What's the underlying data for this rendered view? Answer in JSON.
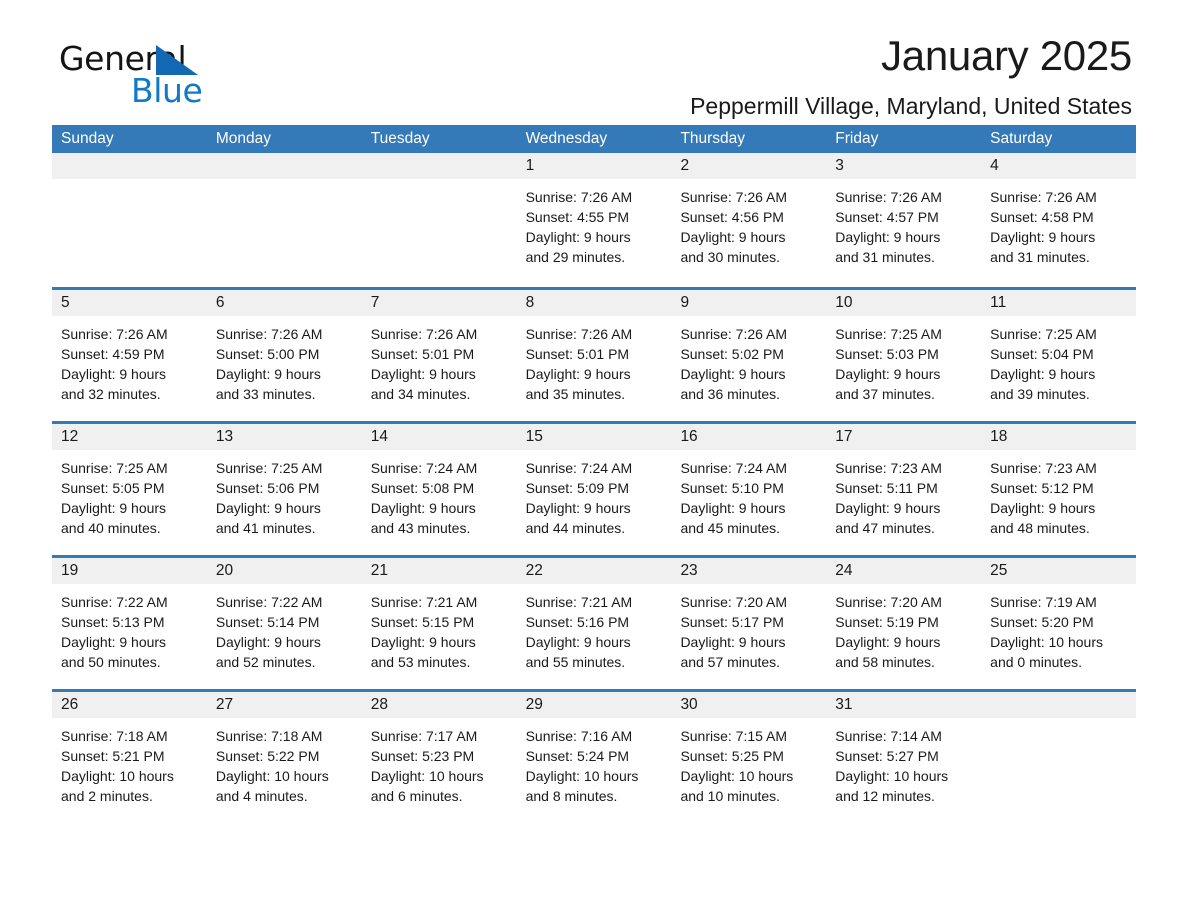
{
  "brand": {
    "name_part1": "General",
    "name_part2": "Blue",
    "accent_color": "#1279c6",
    "triangle_color": "#1268b3"
  },
  "header": {
    "title": "January 2025",
    "subtitle": "Peppermill Village, Maryland, United States"
  },
  "theme": {
    "header_row_bg": "#3479b8",
    "daynum_bg": "#f0f0f0",
    "separator_color": "#3479b8"
  },
  "weekdays": [
    "Sunday",
    "Monday",
    "Tuesday",
    "Wednesday",
    "Thursday",
    "Friday",
    "Saturday"
  ],
  "weeks": [
    [
      {
        "day": "",
        "l1": "",
        "l2": "",
        "l3": "",
        "l4": ""
      },
      {
        "day": "",
        "l1": "",
        "l2": "",
        "l3": "",
        "l4": ""
      },
      {
        "day": "",
        "l1": "",
        "l2": "",
        "l3": "",
        "l4": ""
      },
      {
        "day": "1",
        "l1": "Sunrise: 7:26 AM",
        "l2": "Sunset: 4:55 PM",
        "l3": "Daylight: 9 hours",
        "l4": "and 29 minutes."
      },
      {
        "day": "2",
        "l1": "Sunrise: 7:26 AM",
        "l2": "Sunset: 4:56 PM",
        "l3": "Daylight: 9 hours",
        "l4": "and 30 minutes."
      },
      {
        "day": "3",
        "l1": "Sunrise: 7:26 AM",
        "l2": "Sunset: 4:57 PM",
        "l3": "Daylight: 9 hours",
        "l4": "and 31 minutes."
      },
      {
        "day": "4",
        "l1": "Sunrise: 7:26 AM",
        "l2": "Sunset: 4:58 PM",
        "l3": "Daylight: 9 hours",
        "l4": "and 31 minutes."
      }
    ],
    [
      {
        "day": "5",
        "l1": "Sunrise: 7:26 AM",
        "l2": "Sunset: 4:59 PM",
        "l3": "Daylight: 9 hours",
        "l4": "and 32 minutes."
      },
      {
        "day": "6",
        "l1": "Sunrise: 7:26 AM",
        "l2": "Sunset: 5:00 PM",
        "l3": "Daylight: 9 hours",
        "l4": "and 33 minutes."
      },
      {
        "day": "7",
        "l1": "Sunrise: 7:26 AM",
        "l2": "Sunset: 5:01 PM",
        "l3": "Daylight: 9 hours",
        "l4": "and 34 minutes."
      },
      {
        "day": "8",
        "l1": "Sunrise: 7:26 AM",
        "l2": "Sunset: 5:01 PM",
        "l3": "Daylight: 9 hours",
        "l4": "and 35 minutes."
      },
      {
        "day": "9",
        "l1": "Sunrise: 7:26 AM",
        "l2": "Sunset: 5:02 PM",
        "l3": "Daylight: 9 hours",
        "l4": "and 36 minutes."
      },
      {
        "day": "10",
        "l1": "Sunrise: 7:25 AM",
        "l2": "Sunset: 5:03 PM",
        "l3": "Daylight: 9 hours",
        "l4": "and 37 minutes."
      },
      {
        "day": "11",
        "l1": "Sunrise: 7:25 AM",
        "l2": "Sunset: 5:04 PM",
        "l3": "Daylight: 9 hours",
        "l4": "and 39 minutes."
      }
    ],
    [
      {
        "day": "12",
        "l1": "Sunrise: 7:25 AM",
        "l2": "Sunset: 5:05 PM",
        "l3": "Daylight: 9 hours",
        "l4": "and 40 minutes."
      },
      {
        "day": "13",
        "l1": "Sunrise: 7:25 AM",
        "l2": "Sunset: 5:06 PM",
        "l3": "Daylight: 9 hours",
        "l4": "and 41 minutes."
      },
      {
        "day": "14",
        "l1": "Sunrise: 7:24 AM",
        "l2": "Sunset: 5:08 PM",
        "l3": "Daylight: 9 hours",
        "l4": "and 43 minutes."
      },
      {
        "day": "15",
        "l1": "Sunrise: 7:24 AM",
        "l2": "Sunset: 5:09 PM",
        "l3": "Daylight: 9 hours",
        "l4": "and 44 minutes."
      },
      {
        "day": "16",
        "l1": "Sunrise: 7:24 AM",
        "l2": "Sunset: 5:10 PM",
        "l3": "Daylight: 9 hours",
        "l4": "and 45 minutes."
      },
      {
        "day": "17",
        "l1": "Sunrise: 7:23 AM",
        "l2": "Sunset: 5:11 PM",
        "l3": "Daylight: 9 hours",
        "l4": "and 47 minutes."
      },
      {
        "day": "18",
        "l1": "Sunrise: 7:23 AM",
        "l2": "Sunset: 5:12 PM",
        "l3": "Daylight: 9 hours",
        "l4": "and 48 minutes."
      }
    ],
    [
      {
        "day": "19",
        "l1": "Sunrise: 7:22 AM",
        "l2": "Sunset: 5:13 PM",
        "l3": "Daylight: 9 hours",
        "l4": "and 50 minutes."
      },
      {
        "day": "20",
        "l1": "Sunrise: 7:22 AM",
        "l2": "Sunset: 5:14 PM",
        "l3": "Daylight: 9 hours",
        "l4": "and 52 minutes."
      },
      {
        "day": "21",
        "l1": "Sunrise: 7:21 AM",
        "l2": "Sunset: 5:15 PM",
        "l3": "Daylight: 9 hours",
        "l4": "and 53 minutes."
      },
      {
        "day": "22",
        "l1": "Sunrise: 7:21 AM",
        "l2": "Sunset: 5:16 PM",
        "l3": "Daylight: 9 hours",
        "l4": "and 55 minutes."
      },
      {
        "day": "23",
        "l1": "Sunrise: 7:20 AM",
        "l2": "Sunset: 5:17 PM",
        "l3": "Daylight: 9 hours",
        "l4": "and 57 minutes."
      },
      {
        "day": "24",
        "l1": "Sunrise: 7:20 AM",
        "l2": "Sunset: 5:19 PM",
        "l3": "Daylight: 9 hours",
        "l4": "and 58 minutes."
      },
      {
        "day": "25",
        "l1": "Sunrise: 7:19 AM",
        "l2": "Sunset: 5:20 PM",
        "l3": "Daylight: 10 hours",
        "l4": "and 0 minutes."
      }
    ],
    [
      {
        "day": "26",
        "l1": "Sunrise: 7:18 AM",
        "l2": "Sunset: 5:21 PM",
        "l3": "Daylight: 10 hours",
        "l4": "and 2 minutes."
      },
      {
        "day": "27",
        "l1": "Sunrise: 7:18 AM",
        "l2": "Sunset: 5:22 PM",
        "l3": "Daylight: 10 hours",
        "l4": "and 4 minutes."
      },
      {
        "day": "28",
        "l1": "Sunrise: 7:17 AM",
        "l2": "Sunset: 5:23 PM",
        "l3": "Daylight: 10 hours",
        "l4": "and 6 minutes."
      },
      {
        "day": "29",
        "l1": "Sunrise: 7:16 AM",
        "l2": "Sunset: 5:24 PM",
        "l3": "Daylight: 10 hours",
        "l4": "and 8 minutes."
      },
      {
        "day": "30",
        "l1": "Sunrise: 7:15 AM",
        "l2": "Sunset: 5:25 PM",
        "l3": "Daylight: 10 hours",
        "l4": "and 10 minutes."
      },
      {
        "day": "31",
        "l1": "Sunrise: 7:14 AM",
        "l2": "Sunset: 5:27 PM",
        "l3": "Daylight: 10 hours",
        "l4": "and 12 minutes."
      },
      {
        "day": "",
        "l1": "",
        "l2": "",
        "l3": "",
        "l4": ""
      }
    ]
  ]
}
